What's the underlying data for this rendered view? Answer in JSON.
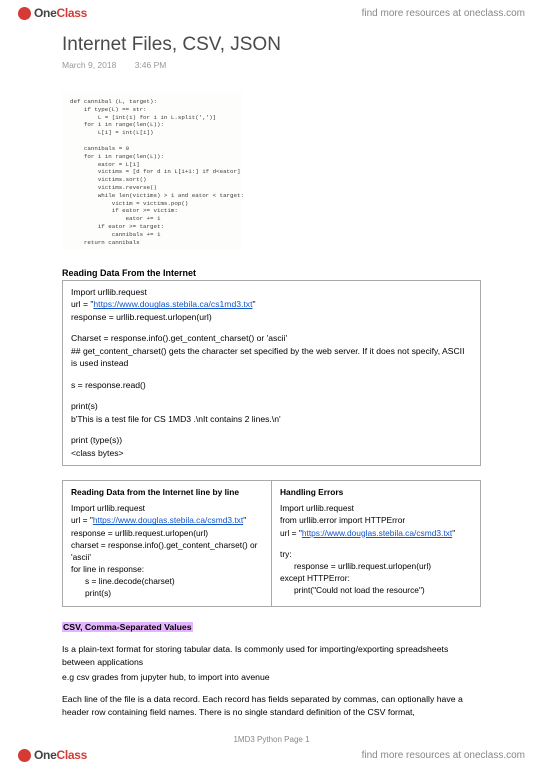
{
  "brand": {
    "one": "One",
    "class": "Class"
  },
  "find_more": "find more resources at oneclass.com",
  "title": "Internet Files, CSV, JSON",
  "date": "March 9, 2018",
  "time": "3:46 PM",
  "code_snippet": "def cannibal (L, target):\n    if type(L) == str:\n        L = [int(i) for i in L.split(',')]\n    for i in range(len(L)):\n        L[i] = int(L[i])\n\n    cannibals = 0\n    for i in range(len(L)):\n        eator = L[i]\n        victims = [d for d in L[i+1:] if d<eator]\n        victims.sort()\n        victims.reverse()\n        while len(victims) > 1 and eator < target:\n            victim = victims.pop()\n            if eator >= victim:\n                eator += 1\n        if eator >= target:\n            cannibals += 1\n    return cannibals",
  "section1_h": "Reading Data From the Internet",
  "section1": {
    "l1": "Import urllib.request",
    "l2a": "url = \"",
    "l2link": "https://www.douglas.stebila.ca/cs1md3.txt",
    "l2b": "\"",
    "l3": "response = urllib.request.urlopen(url)",
    "l4": "Charset = response.info().get_content_charset() or 'ascii'",
    "l5": "## get_content_charset() gets the character set specified by the web server. If it does not specify, ASCII is used instead",
    "l6": "s = response.read()",
    "l7": "print(s)",
    "l8": "b'This is a test file for CS 1MD3 .\\nIt contains 2 lines.\\n'",
    "l9": "print (type(s))",
    "l10": "<class bytes>"
  },
  "col_left_h": "Reading Data from the Internet line by line",
  "col_left": {
    "l1": "Import urllib.request",
    "l2a": "url = \"",
    "l2link": "https://www.douglas.stebila.ca/csmd3.txt",
    "l2b": "\"",
    "l3": "response = urllib.request.urlopen(url)",
    "l4": "charset = response.info().get_content_charset() or 'ascii'",
    "l5": "for line in response:",
    "l6": "s = line.decode(charset)",
    "l7": "print(s)"
  },
  "col_right_h": "Handling Errors",
  "col_right": {
    "l1": "Import urllib.request",
    "l2": "from urllib.error import HTTPError",
    "l3a": "url = \"",
    "l3link": "https://www.douglas.stebila.ca/csmd3.txt",
    "l3b": "\"",
    "l4": "try:",
    "l5": "response = urllib.request.urlopen(url)",
    "l6": "except HTTPError:",
    "l7": "print(\"Could not load the resource\")"
  },
  "csv_h": "CSV, Comma-Separated Values",
  "p1": "Is a plain-text format for storing tabular data. Is commonly used for importing/exporting spreadsheets between applications",
  "p2": "e.g csv grades from jupyter hub, to import into avenue",
  "p3": "Each line of the file is a data record. Each record has fields separated by commas, can optionally have a header row containing field names. There is no single standard definition of the CSV format,",
  "page_label": "1MD3 Python Page 1"
}
